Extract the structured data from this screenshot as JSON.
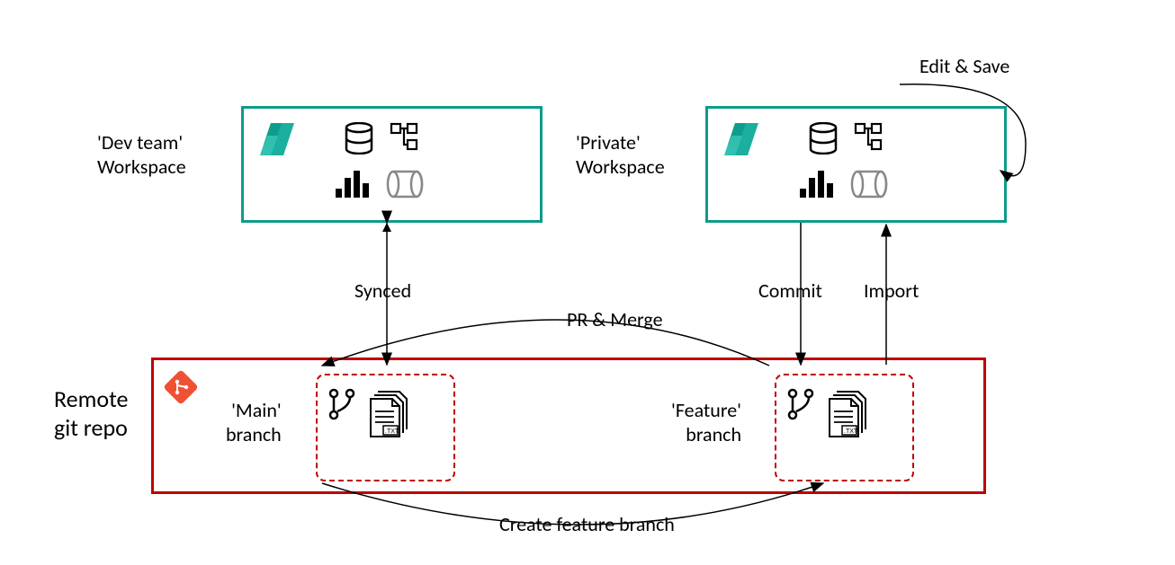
{
  "labels": {
    "devTeamWorkspaceLine1": "'Dev team'",
    "devTeamWorkspaceLine2": "Workspace",
    "privateWorkspaceLine1": "'Private'",
    "privateWorkspaceLine2": "Workspace",
    "remoteGitRepoLine1": "Remote",
    "remoteGitRepoLine2": "git repo",
    "mainBranchLine1": "'Main'",
    "mainBranchLine2": "branch",
    "featureBranchLine1": "'Feature'",
    "featureBranchLine2": "branch",
    "synced": "Synced",
    "commit": "Commit",
    "import": "Import",
    "prMerge": "PR & Merge",
    "createFeatureBranch": "Create feature branch",
    "editSave": "Edit & Save"
  },
  "icons": {
    "fabric": "fabric-logo",
    "database": "database-icon",
    "pipeline": "pipeline-icon",
    "barChart": "bar-chart-icon",
    "lens": "lens-icon",
    "git": "git-icon",
    "branchFork": "branch-fork-icon",
    "fileStack": "file-stack-icon"
  }
}
